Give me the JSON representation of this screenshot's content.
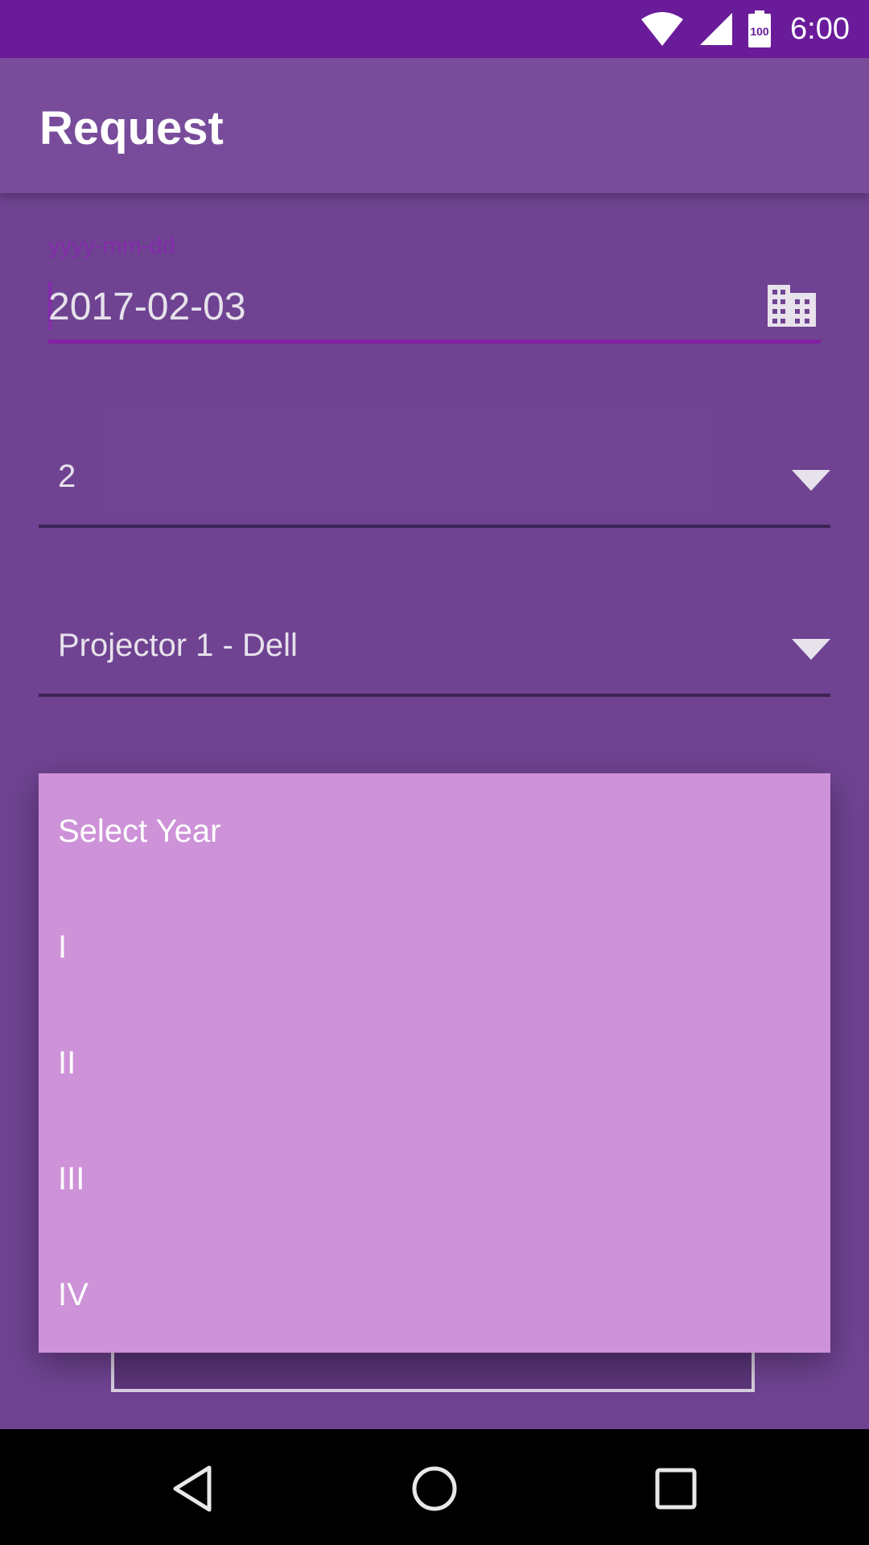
{
  "status_bar": {
    "time": "6:00",
    "battery_level": "100",
    "icons": [
      "wifi-icon",
      "cell-signal-icon",
      "battery-icon"
    ]
  },
  "app_bar": {
    "title": "Request"
  },
  "form": {
    "date_field": {
      "hint": "yyyy-mm-dd",
      "value": "2017-02-03",
      "icon": "calendar-building-icon"
    },
    "quantity_spinner": {
      "selected": "2"
    },
    "equipment_spinner": {
      "selected": "Projector 1 - Dell"
    }
  },
  "year_dropdown": {
    "items": [
      "Select Year",
      "I",
      "II",
      "III",
      "IV"
    ]
  },
  "nav_bar": {
    "icons": [
      "back-icon",
      "home-icon",
      "recents-icon"
    ]
  },
  "colors": {
    "status_bar": "#6a1b9a",
    "background": "#774b9a",
    "accent": "#8e24aa",
    "dropdown": "#cd92d8"
  }
}
